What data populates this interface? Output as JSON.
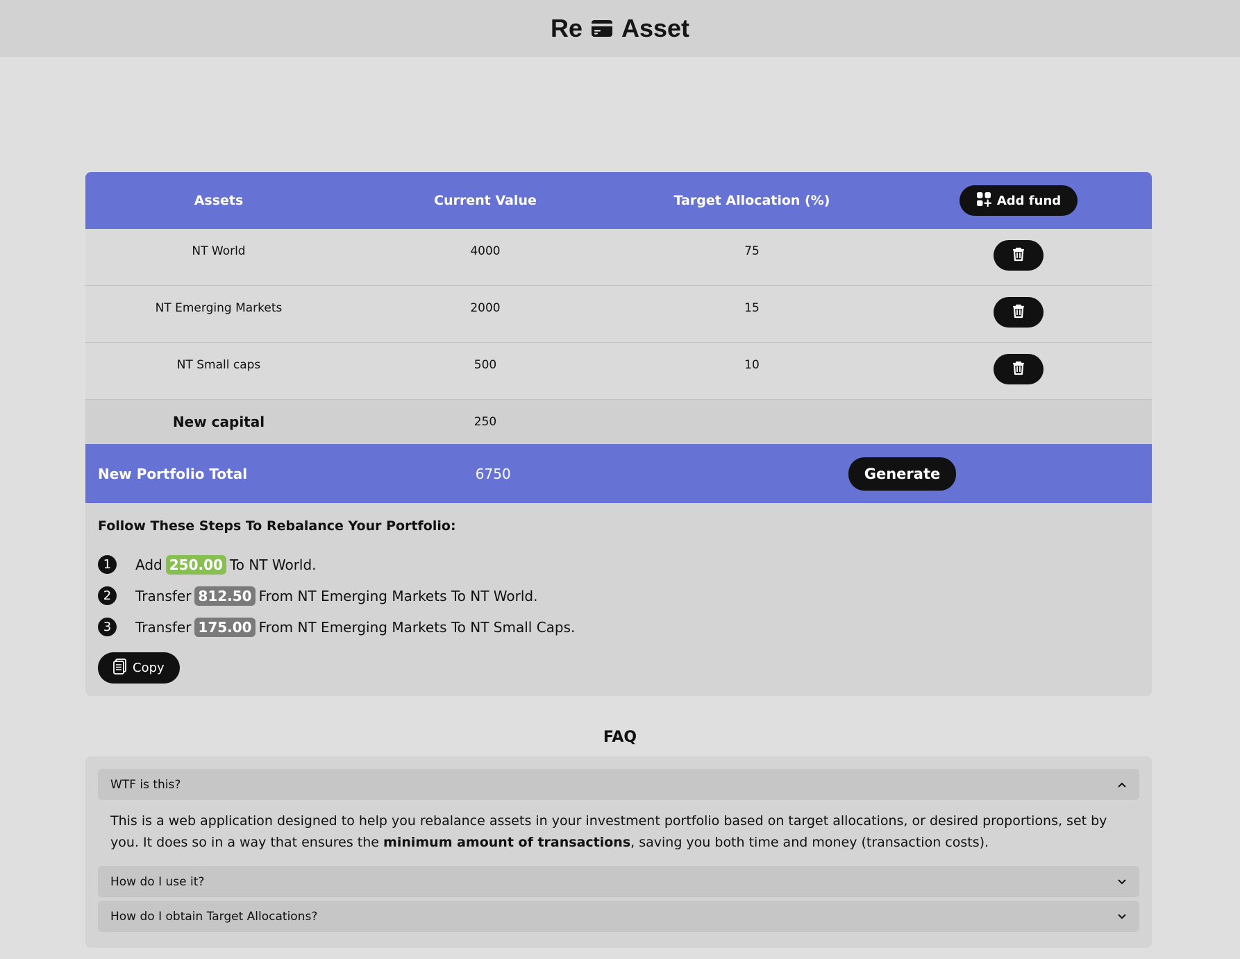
{
  "header": {
    "brand_left": "Re",
    "brand_right": "Asset",
    "brand_icon": "credit-card-icon"
  },
  "table": {
    "columns": [
      "Assets",
      "Current Value",
      "Target Allocation (%)"
    ],
    "add_fund_label": "Add fund",
    "rows": [
      {
        "asset": "NT World",
        "value": "4000",
        "target": "75"
      },
      {
        "asset": "NT Emerging Markets",
        "value": "2000",
        "target": "15"
      },
      {
        "asset": "NT Small caps",
        "value": "500",
        "target": "10"
      }
    ],
    "new_capital_label": "New capital",
    "new_capital_value": "250",
    "total_label": "New Portfolio Total",
    "total_value": "6750",
    "generate_label": "Generate"
  },
  "steps": {
    "title": "Follow These Steps To Rebalance Your Portfolio:",
    "items": [
      {
        "num": "1",
        "verb": "Add",
        "amount": "250.00",
        "rest": "To NT World."
      },
      {
        "num": "2",
        "verb": "Transfer",
        "amount": "812.50",
        "rest": "From NT Emerging Markets To NT World."
      },
      {
        "num": "3",
        "verb": "Transfer",
        "amount": "175.00",
        "rest": "From NT Emerging Markets To NT Small Caps."
      }
    ],
    "copy_label": "Copy"
  },
  "faq": {
    "title": "FAQ",
    "items": [
      {
        "question": "WTF is this?",
        "expanded": true
      },
      {
        "question": "How do I use it?",
        "expanded": false
      },
      {
        "question": "How do I obtain Target Allocations?",
        "expanded": false
      }
    ],
    "answer_before": "This is a web application designed to help you rebalance assets in your investment portfolio based on target allocations, or desired proportions, set by you. It does so in a way that ensures the ",
    "answer_bold": "minimum amount of transactions",
    "answer_after": ", saving you both time and money (transaction costs)."
  },
  "colors": {
    "accent": "#6673d5",
    "add_amount": "#88bf51",
    "transfer_amount": "#7a7a7a",
    "button": "#111111"
  }
}
